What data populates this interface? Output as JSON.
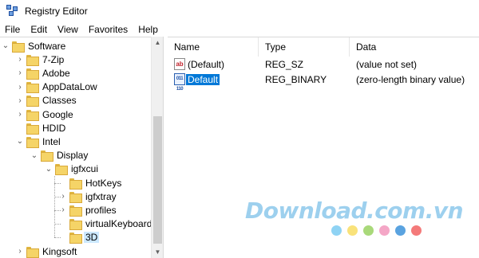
{
  "window": {
    "title": "Registry Editor"
  },
  "menu": [
    "File",
    "Edit",
    "View",
    "Favorites",
    "Help"
  ],
  "tree": {
    "items": [
      {
        "label": "Software",
        "level": 0,
        "expander": "expanded"
      },
      {
        "label": "7-Zip",
        "level": 1,
        "expander": "collapsed"
      },
      {
        "label": "Adobe",
        "level": 1,
        "expander": "collapsed"
      },
      {
        "label": "AppDataLow",
        "level": 1,
        "expander": "collapsed"
      },
      {
        "label": "Classes",
        "level": 1,
        "expander": "collapsed"
      },
      {
        "label": "Google",
        "level": 1,
        "expander": "collapsed"
      },
      {
        "label": "HDID",
        "level": 1,
        "expander": "none"
      },
      {
        "label": "Intel",
        "level": 1,
        "expander": "expanded"
      },
      {
        "label": "Display",
        "level": 2,
        "expander": "expanded"
      },
      {
        "label": "igfxcui",
        "level": 3,
        "expander": "expanded"
      },
      {
        "label": "HotKeys",
        "level": 4,
        "expander": "none"
      },
      {
        "label": "igfxtray",
        "level": 4,
        "expander": "collapsed"
      },
      {
        "label": "profiles",
        "level": 4,
        "expander": "collapsed"
      },
      {
        "label": "virtualKeyboard",
        "level": 4,
        "expander": "none"
      },
      {
        "label": "3D",
        "level": 4,
        "expander": "none",
        "selected": true
      },
      {
        "label": "Kingsoft",
        "level": 1,
        "expander": "collapsed"
      }
    ]
  },
  "list": {
    "columns": [
      "Name",
      "Type",
      "Data"
    ],
    "rows": [
      {
        "icon": "string-value-icon",
        "icon_text": "ab",
        "name": "(Default)",
        "type": "REG_SZ",
        "data": "(value not set)"
      },
      {
        "icon": "binary-value-icon",
        "icon_text": "011 110",
        "name": "Default",
        "type": "REG_BINARY",
        "data": "(zero-length binary value)",
        "editing": true
      }
    ]
  },
  "watermark": {
    "text": "Download.com.vn",
    "dot_colors": [
      "#8fd3f4",
      "#f9e27a",
      "#a9d97a",
      "#f4a6c6",
      "#5aa3e0",
      "#f47a7a"
    ]
  },
  "colors": {
    "folder": "#f5d467",
    "selection": "#0078d7",
    "tree_selection": "#cce8ff"
  }
}
